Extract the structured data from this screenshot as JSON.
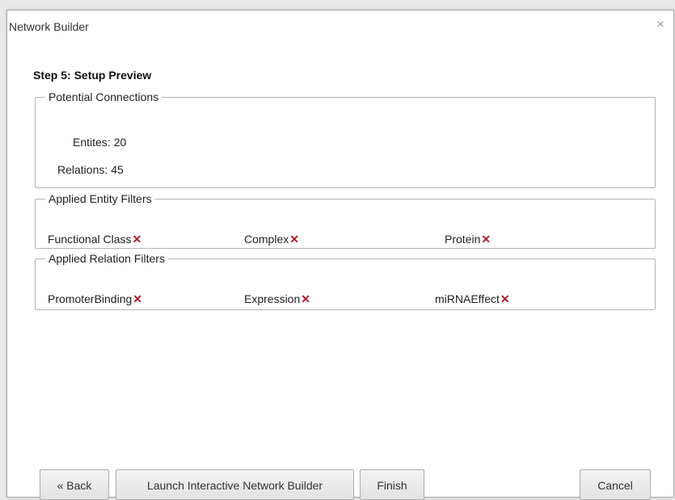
{
  "window": {
    "title": "Network Builder",
    "close_glyph": "×"
  },
  "step_title": "Step 5: Setup Preview",
  "potential_connections": {
    "legend": "Potential Connections",
    "entities_label": "Entites:",
    "entities_value": "20",
    "relations_label": "Relations:",
    "relations_value": "45"
  },
  "entity_filters": {
    "legend": "Applied Entity Filters",
    "items": [
      {
        "label": "Functional Class"
      },
      {
        "label": "Complex"
      },
      {
        "label": "Protein"
      }
    ]
  },
  "relation_filters": {
    "legend": "Applied Relation Filters",
    "items": [
      {
        "label": "PromoterBinding"
      },
      {
        "label": "Expression"
      },
      {
        "label": "miRNAEffect"
      }
    ]
  },
  "remove_glyph": "✕",
  "buttons": {
    "back": "« Back",
    "launch": "Launch Interactive Network Builder",
    "finish": "Finish",
    "cancel": "Cancel"
  },
  "colors": {
    "remove_icon": "#b01c2e",
    "button_border": "#acacac",
    "group_border": "#b4b4b4"
  }
}
